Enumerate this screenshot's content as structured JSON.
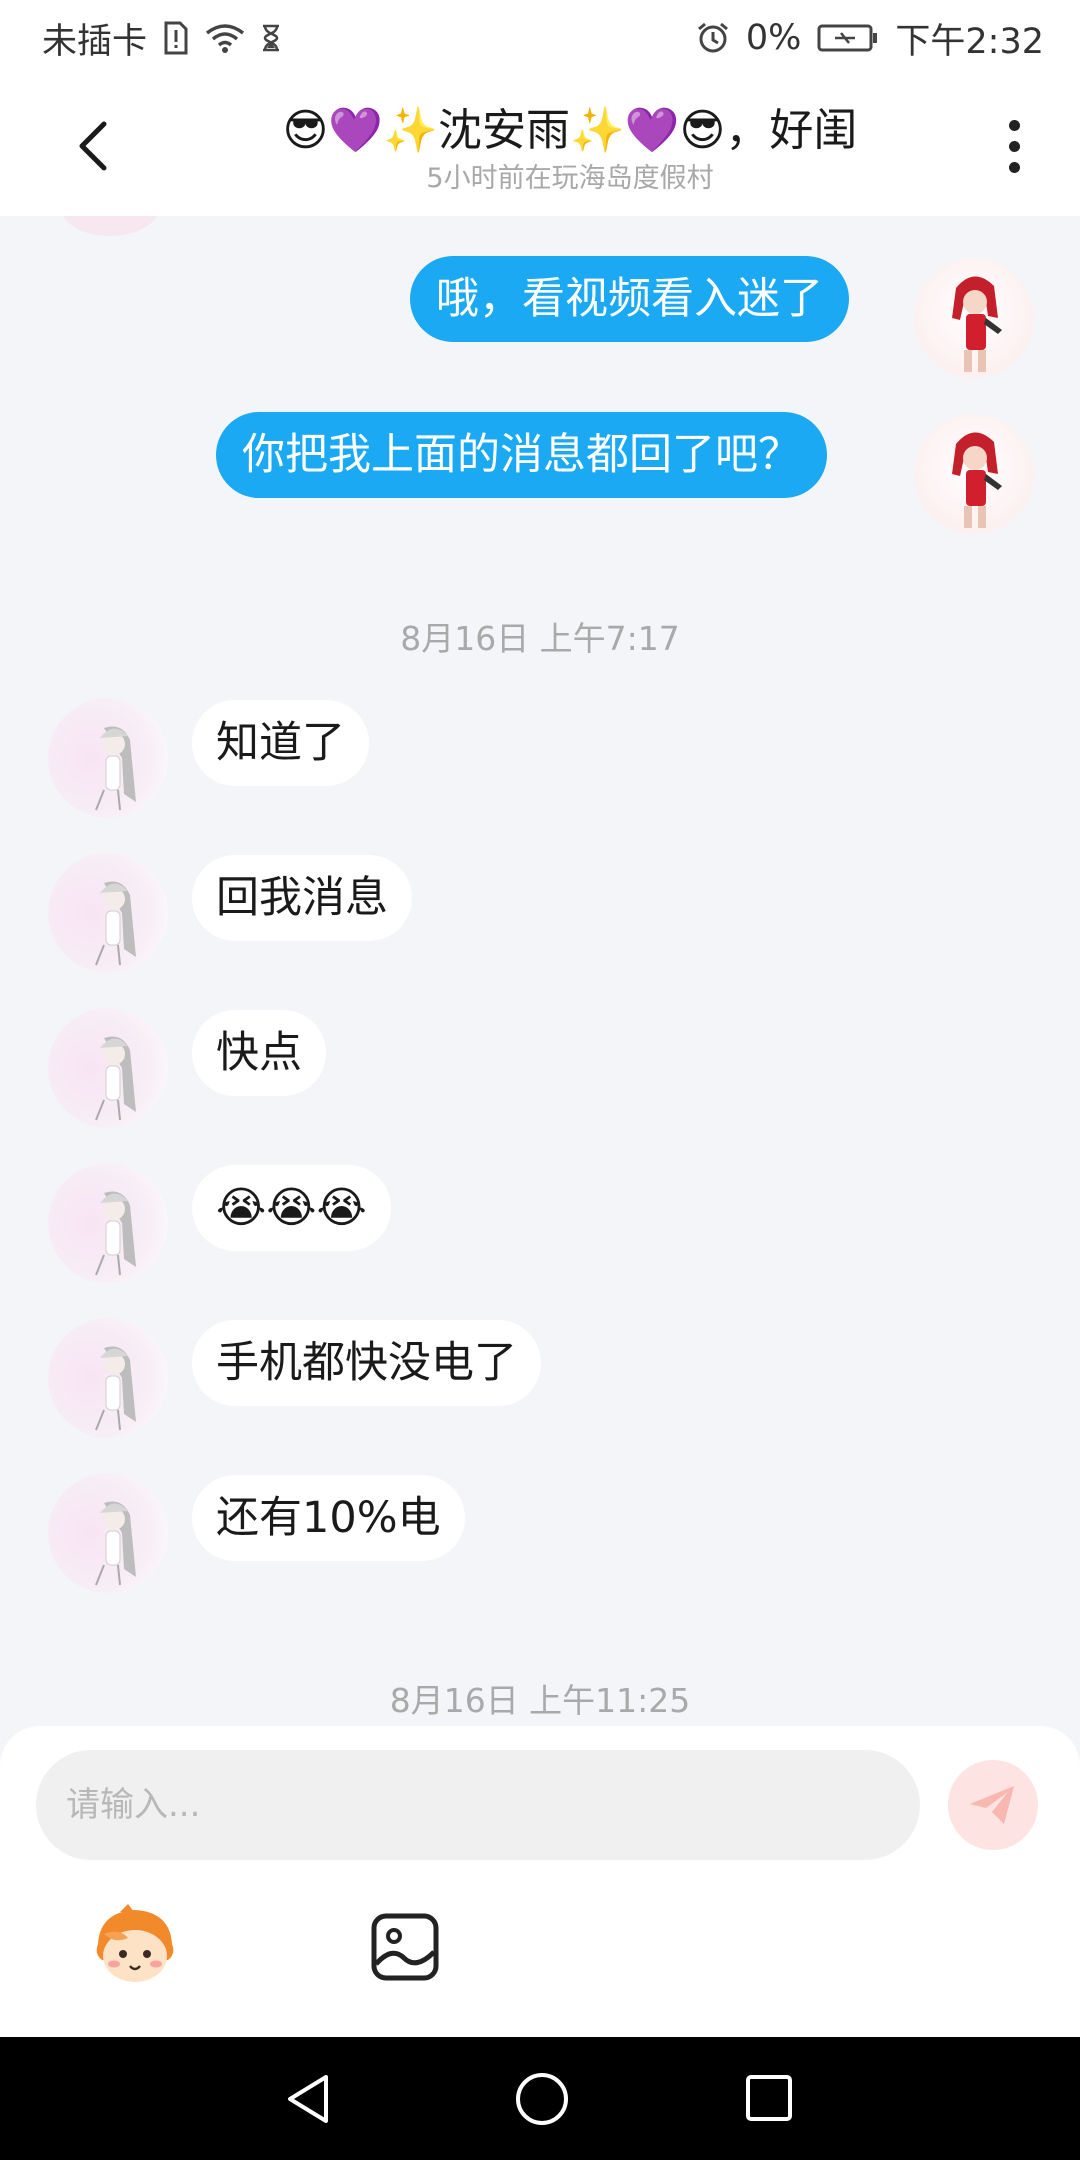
{
  "status_bar": {
    "carrier": "未插卡",
    "battery_percent": "0%",
    "time": "下午2:32"
  },
  "header": {
    "title": "😎💜✨沈安雨✨💜😎，好闺",
    "subtitle": "5小时前在玩海岛度假村"
  },
  "messages": {
    "out": [
      "哦，看视频看入迷了",
      "你把我上面的消息都回了吧？"
    ],
    "in": [
      "知道了",
      "回我消息",
      "快点",
      "😭😭😭",
      "手机都快没电了",
      "还有10%电"
    ]
  },
  "timestamps": [
    "8月16日 上午7:17",
    "8月16日 上午11:25"
  ],
  "input": {
    "placeholder": "请输入..."
  },
  "icons": {
    "back": "chevron-left-icon",
    "more": "more-vertical-icon",
    "send": "paper-plane-icon",
    "mascot": "mascot-emoji-icon",
    "image": "image-icon"
  },
  "colors": {
    "outgoing_bubble": "#1aa9f2",
    "incoming_bubble": "#ffffff",
    "chat_background": "#f3f5f9",
    "send_button": "#fde3e1"
  }
}
